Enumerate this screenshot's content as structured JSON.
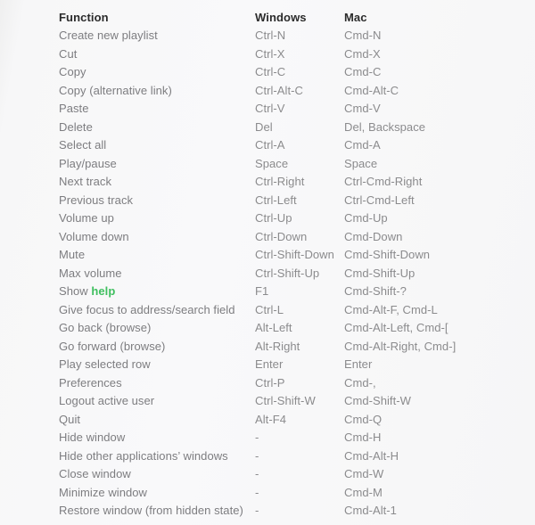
{
  "table": {
    "headers": {
      "function": "Function",
      "windows": "Windows",
      "mac": "Mac"
    },
    "colors": {
      "header_text": "#2b2b2b",
      "body_text": "#8b8b8d",
      "link_green": "#3fbf5f",
      "background": "#f7f7f8"
    },
    "rows": [
      {
        "function": "Create new playlist",
        "windows": "Ctrl-N",
        "mac": "Cmd-N"
      },
      {
        "function": "Cut",
        "windows": "Ctrl-X",
        "mac": "Cmd-X"
      },
      {
        "function": "Copy",
        "windows": "Ctrl-C",
        "mac": "Cmd-C"
      },
      {
        "function": "Copy (alternative link)",
        "windows": "Ctrl-Alt-C",
        "mac": "Cmd-Alt-C"
      },
      {
        "function": "Paste",
        "windows": "Ctrl-V",
        "mac": "Cmd-V"
      },
      {
        "function": "Delete",
        "windows": "Del",
        "mac": "Del, Backspace"
      },
      {
        "function": "Select all",
        "windows": "Ctrl-A",
        "mac": "Cmd-A"
      },
      {
        "function": "Play/pause",
        "windows": "Space",
        "mac": "Space"
      },
      {
        "function": "Next track",
        "windows": "Ctrl-Right",
        "mac": "Ctrl-Cmd-Right"
      },
      {
        "function": "Previous track",
        "windows": "Ctrl-Left",
        "mac": "Ctrl-Cmd-Left"
      },
      {
        "function": "Volume up",
        "windows": "Ctrl-Up",
        "mac": "Cmd-Up"
      },
      {
        "function": "Volume down",
        "windows": "Ctrl-Down",
        "mac": "Cmd-Down"
      },
      {
        "function": "Mute",
        "windows": "Ctrl-Shift-Down",
        "mac": "Cmd-Shift-Down"
      },
      {
        "function": "Max volume",
        "windows": "Ctrl-Shift-Up",
        "mac": "Cmd-Shift-Up"
      },
      {
        "function": "Show help",
        "function_prefix": "Show ",
        "function_link": "help",
        "windows": "F1",
        "mac": "Cmd-Shift-?"
      },
      {
        "function": "Give focus to address/search field",
        "windows": "Ctrl-L",
        "mac": "Cmd-Alt-F, Cmd-L"
      },
      {
        "function": "Go back (browse)",
        "windows": "Alt-Left",
        "mac": "Cmd-Alt-Left, Cmd-["
      },
      {
        "function": "Go forward (browse)",
        "windows": "Alt-Right",
        "mac": "Cmd-Alt-Right, Cmd-]"
      },
      {
        "function": "Play selected row",
        "windows": "Enter",
        "mac": "Enter"
      },
      {
        "function": "Preferences",
        "windows": "Ctrl-P",
        "mac": "Cmd-,"
      },
      {
        "function": "Logout active user",
        "windows": "Ctrl-Shift-W",
        "mac": "Cmd-Shift-W"
      },
      {
        "function": "Quit",
        "windows": "Alt-F4",
        "mac": "Cmd-Q"
      },
      {
        "function": "Hide window",
        "windows": "-",
        "mac": "Cmd-H"
      },
      {
        "function": "Hide other applications’ windows",
        "windows": "-",
        "mac": "Cmd-Alt-H"
      },
      {
        "function": "Close window",
        "windows": "-",
        "mac": "Cmd-W"
      },
      {
        "function": "Minimize window",
        "windows": "-",
        "mac": "Cmd-M"
      },
      {
        "function": "Restore window (from hidden state)",
        "windows": "-",
        "mac": "Cmd-Alt-1"
      }
    ]
  }
}
